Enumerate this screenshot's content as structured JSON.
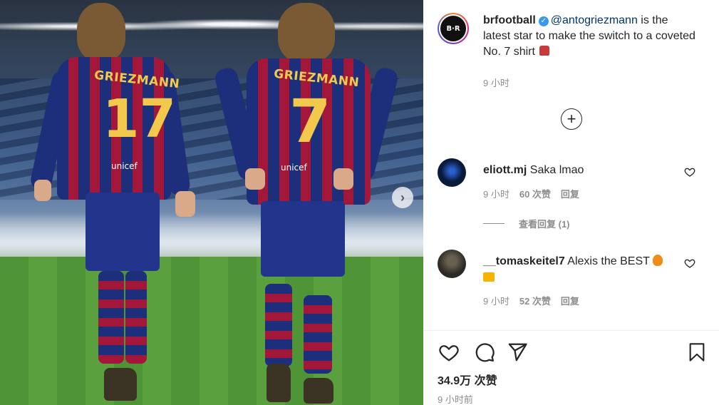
{
  "post": {
    "username": "brfootball",
    "avatar_text": "B·R",
    "caption_mention": "@antogriezmann",
    "caption_text": " is the latest star to make the switch to a coveted No. 7 shirt ",
    "time": "9 小时"
  },
  "image": {
    "left_player_name": "GRIEZMANN",
    "left_player_number": "17",
    "right_player_name": "GRIEZMANN",
    "right_player_number": "7",
    "sponsor": "unicef"
  },
  "comments": [
    {
      "username": "eliott.mj",
      "text": "Saka lmao",
      "time": "9 小时",
      "likes": "60 次赞",
      "reply_label": "回复",
      "view_replies": "查看回复 (1)",
      "avatar_color": "#0a1a3a"
    },
    {
      "username": "__tomaskeitel7",
      "text": "Alexis the BEST",
      "time": "9 小时",
      "likes": "52 次赞",
      "reply_label": "回复",
      "avatar_color": "#3b3a34"
    }
  ],
  "footer": {
    "likes": "34.9万 次赞",
    "posted": "9 小时前"
  },
  "icons": {
    "like": "heart-icon",
    "comment": "comment-icon",
    "share": "share-icon",
    "save": "bookmark-icon",
    "load_more": "plus-circle-icon",
    "next": "chevron-right-icon",
    "verified": "verified-badge-icon"
  },
  "colors": {
    "mention": "#00376b",
    "verified": "#3897f0",
    "muted": "#8e8e8e"
  }
}
